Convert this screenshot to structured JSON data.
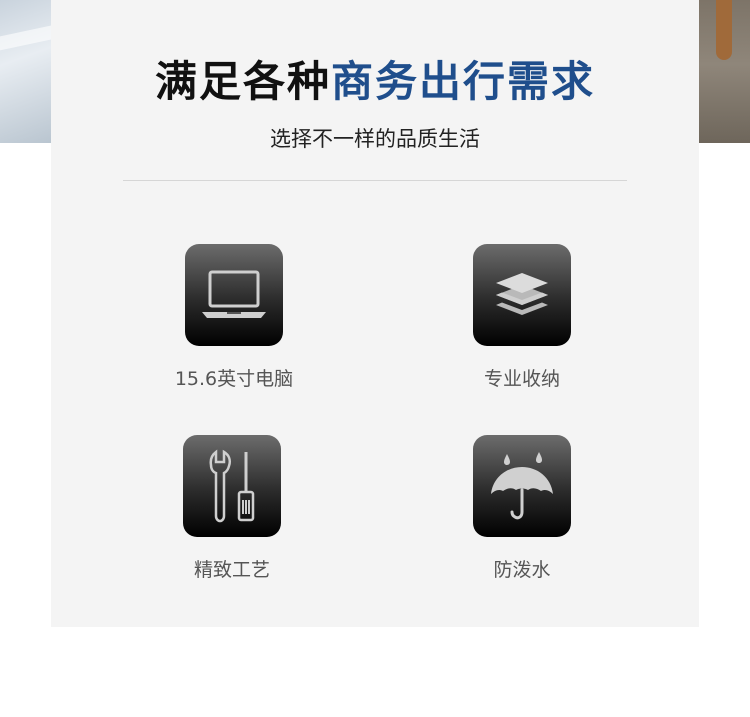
{
  "title": {
    "part1": "满足各种",
    "part2": "商务出行需求"
  },
  "subtitle": "选择不一样的品质生活",
  "features": [
    {
      "label": "15.6英寸电脑",
      "icon": "laptop-icon"
    },
    {
      "label": "专业收纳",
      "icon": "layers-icon"
    },
    {
      "label": "精致工艺",
      "icon": "tools-icon"
    },
    {
      "label": "防泼水",
      "icon": "umbrella-icon"
    }
  ],
  "colors": {
    "accent_blue": "#1f4e8c",
    "card_bg": "#f4f4f4",
    "text_dark": "#111111",
    "label_gray": "#555555"
  }
}
